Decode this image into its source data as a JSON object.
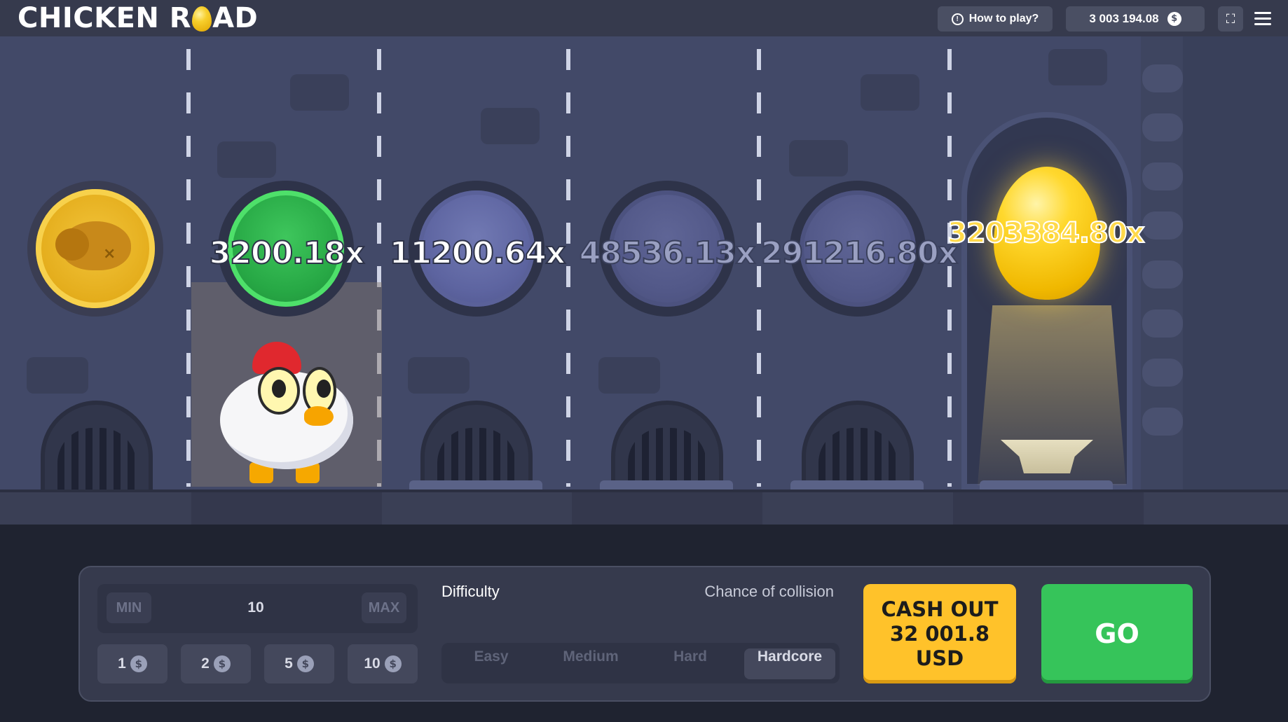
{
  "header": {
    "logo_left": "CHICKEN R",
    "logo_right": "AD",
    "how_to_play": "How to play?",
    "balance": "3 003 194.08",
    "currency_icon": "$"
  },
  "lanes": [
    {
      "state": "passed",
      "icon": "roast-chicken-icon"
    },
    {
      "state": "current",
      "multiplier": "3200.18x"
    },
    {
      "state": "next",
      "multiplier": "11200.64x"
    },
    {
      "state": "upcoming",
      "multiplier": "48536.13x"
    },
    {
      "state": "upcoming",
      "multiplier": "291216.80x"
    },
    {
      "state": "final",
      "multiplier": "3203384.80x",
      "icon": "golden-egg-icon"
    }
  ],
  "controls": {
    "min_label": "MIN",
    "max_label": "MAX",
    "bet_value": "10",
    "chips": [
      "1",
      "2",
      "5",
      "10"
    ],
    "difficulty_label": "Difficulty",
    "collision_label": "Chance of collision",
    "difficulties": [
      "Easy",
      "Medium",
      "Hard",
      "Hardcore"
    ],
    "selected_difficulty": "Hardcore",
    "cashout_line1": "CASH OUT",
    "cashout_line2": "32 001.8 USD",
    "go_label": "GO"
  },
  "colors": {
    "accent_green": "#36c45a",
    "accent_gold": "#ffc22a",
    "background": "#424968"
  }
}
